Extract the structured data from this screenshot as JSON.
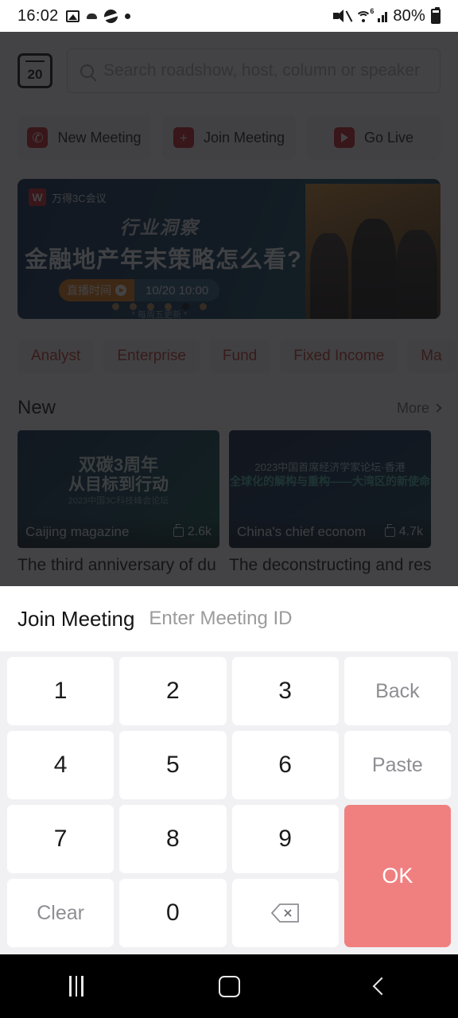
{
  "status_bar": {
    "time": "16:02",
    "battery_percent": "80%",
    "wifi_generation": "6",
    "icons": [
      "photo-icon",
      "cloud-icon",
      "saturn-icon",
      "dot-icon",
      "mute-icon",
      "wifi-icon",
      "signal-icon",
      "battery-icon"
    ]
  },
  "app": {
    "calendar_day": "20",
    "search": {
      "placeholder": "Search roadshow, host, column or speaker"
    },
    "actions": [
      {
        "label": "New Meeting",
        "icon": "phone-icon"
      },
      {
        "label": "Join Meeting",
        "icon": "plus-icon"
      },
      {
        "label": "Go Live",
        "icon": "play-icon"
      }
    ],
    "banner": {
      "logo_mark": "W",
      "logo_text": "万得3C会议",
      "subtitle": "行业洞察",
      "title": "金融地产年末策略怎么看?",
      "time_label": "直播时间",
      "time_value": "10/20 10:00",
      "footer": "* 每周五更新 *",
      "dot_count": 6,
      "active_dot": 5
    },
    "chips": [
      "Analyst",
      "Enterprise",
      "Fund",
      "Fixed Income",
      "Ma"
    ],
    "section": {
      "heading": "New",
      "more_label": "More"
    },
    "cards": [
      {
        "thumb_line1": "双碳3周年",
        "thumb_line2": "从目标到行动",
        "thumb_line3": "2023中国3C科技峰会论坛",
        "channel": "Caijing magazine",
        "likes": "2.6k",
        "title": "The third anniversary of du"
      },
      {
        "thumb_line1": "2023中国首席经济学家论坛·香港",
        "thumb_line2": "全球化的解构与重构——大湾区的新使命",
        "thumb_line3": "",
        "channel": "China's chief econom",
        "likes": "4.7k",
        "title": "The deconstructing and res"
      }
    ]
  },
  "sheet": {
    "title": "Join Meeting",
    "input_placeholder": "Enter Meeting ID",
    "input_value": "",
    "keys": [
      {
        "label": "1",
        "type": "digit"
      },
      {
        "label": "2",
        "type": "digit"
      },
      {
        "label": "3",
        "type": "digit"
      },
      {
        "label": "Back",
        "type": "word"
      },
      {
        "label": "4",
        "type": "digit"
      },
      {
        "label": "5",
        "type": "digit"
      },
      {
        "label": "6",
        "type": "digit"
      },
      {
        "label": "Paste",
        "type": "word"
      },
      {
        "label": "7",
        "type": "digit"
      },
      {
        "label": "8",
        "type": "digit"
      },
      {
        "label": "9",
        "type": "digit"
      },
      {
        "label": "Clear",
        "type": "word"
      },
      {
        "label": "0",
        "type": "digit"
      },
      {
        "label": "",
        "type": "backspace-icon"
      }
    ],
    "ok_label": "OK",
    "ok_color": "#f08080"
  },
  "nav_bar": {
    "recents": "recents-icon",
    "home": "home-icon",
    "back": "back-icon"
  }
}
